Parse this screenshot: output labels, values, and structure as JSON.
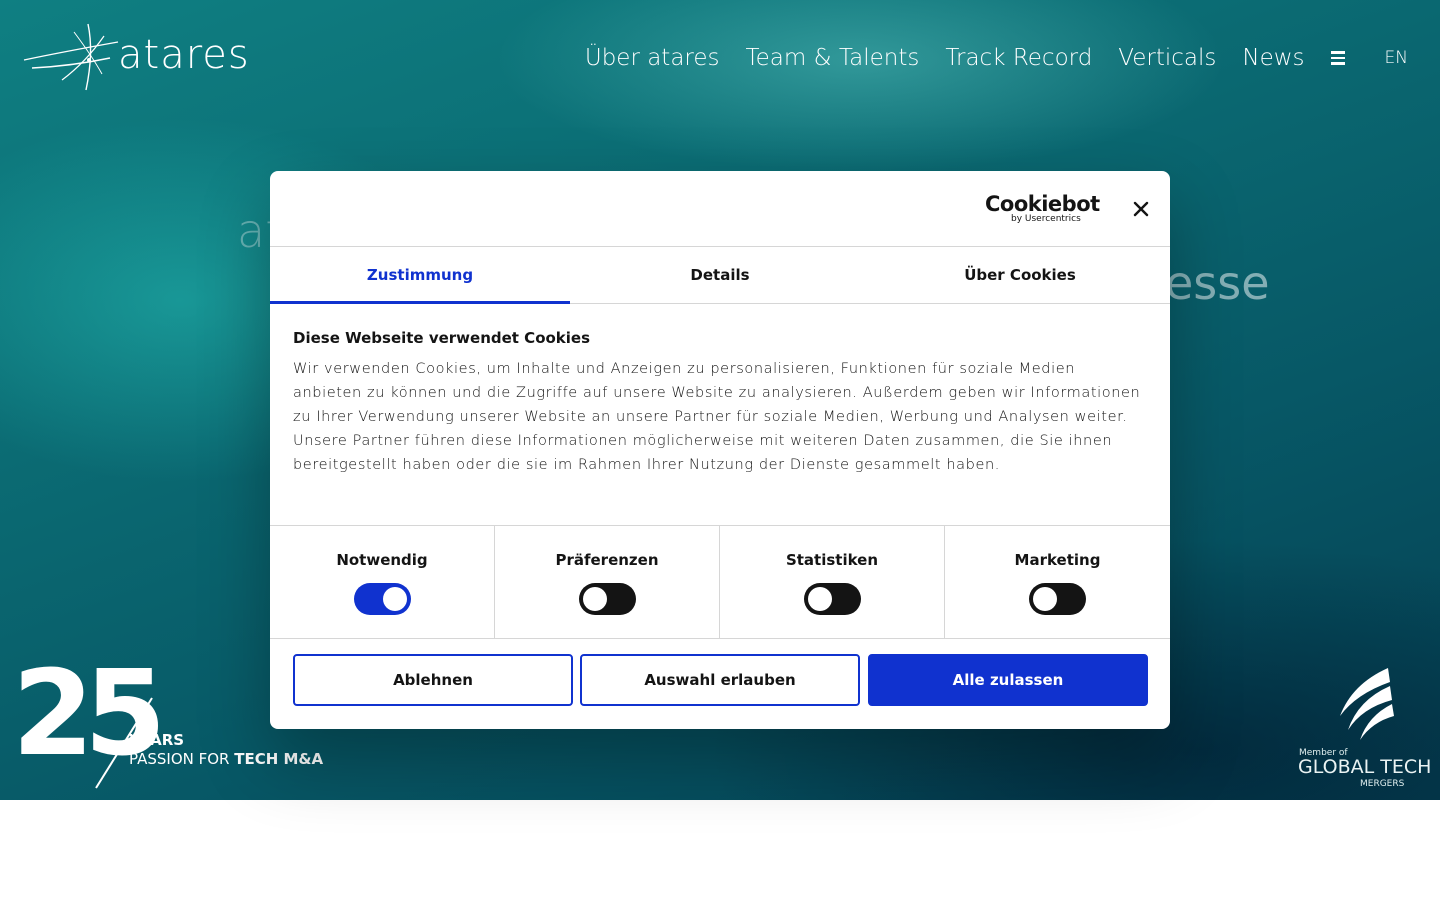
{
  "header": {
    "logo_text": "atares",
    "nav": [
      "Über atares",
      "Team & Talents",
      "Track Record",
      "Verticals",
      "News"
    ],
    "language": "EN"
  },
  "hero": {
    "text_left": "at",
    "text_right": "esse"
  },
  "badge_25": {
    "number": "25",
    "line1": "YEARS",
    "line2_prefix": "PASSION FOR ",
    "line2_bold": "TECH M&A"
  },
  "gtm": {
    "member": "Member of",
    "name": "GLOBAL TECH",
    "sub": "MERGERS"
  },
  "dialog": {
    "brand": "Cookiebot",
    "brand_sub": "by Usercentrics",
    "tabs": [
      "Zustimmung",
      "Details",
      "Über Cookies"
    ],
    "title": "Diese Webseite verwendet Cookies",
    "text": "Wir verwenden Cookies, um Inhalte und Anzeigen zu personalisieren, Funktionen für soziale Medien anbieten zu können und die Zugriffe auf unsere Website zu analysieren. Außerdem geben wir Informationen zu Ihrer Verwendung unserer Website an unsere Partner für soziale Medien, Werbung und Analysen weiter. Unsere Partner führen diese Informationen möglicherweise mit weiteren Daten zusammen, die Sie ihnen bereitgestellt haben oder die sie im Rahmen Ihrer Nutzung der Dienste gesammelt haben.",
    "categories": [
      {
        "label": "Notwendig",
        "enabled": true
      },
      {
        "label": "Präferenzen",
        "enabled": false
      },
      {
        "label": "Statistiken",
        "enabled": false
      },
      {
        "label": "Marketing",
        "enabled": false
      }
    ],
    "buttons": {
      "decline": "Ablehnen",
      "allow_selection": "Auswahl erlauben",
      "allow_all": "Alle zulassen"
    }
  },
  "colors": {
    "accent": "#1032cf",
    "hero_teal": "#0b6b73",
    "switch_off": "#141414"
  }
}
